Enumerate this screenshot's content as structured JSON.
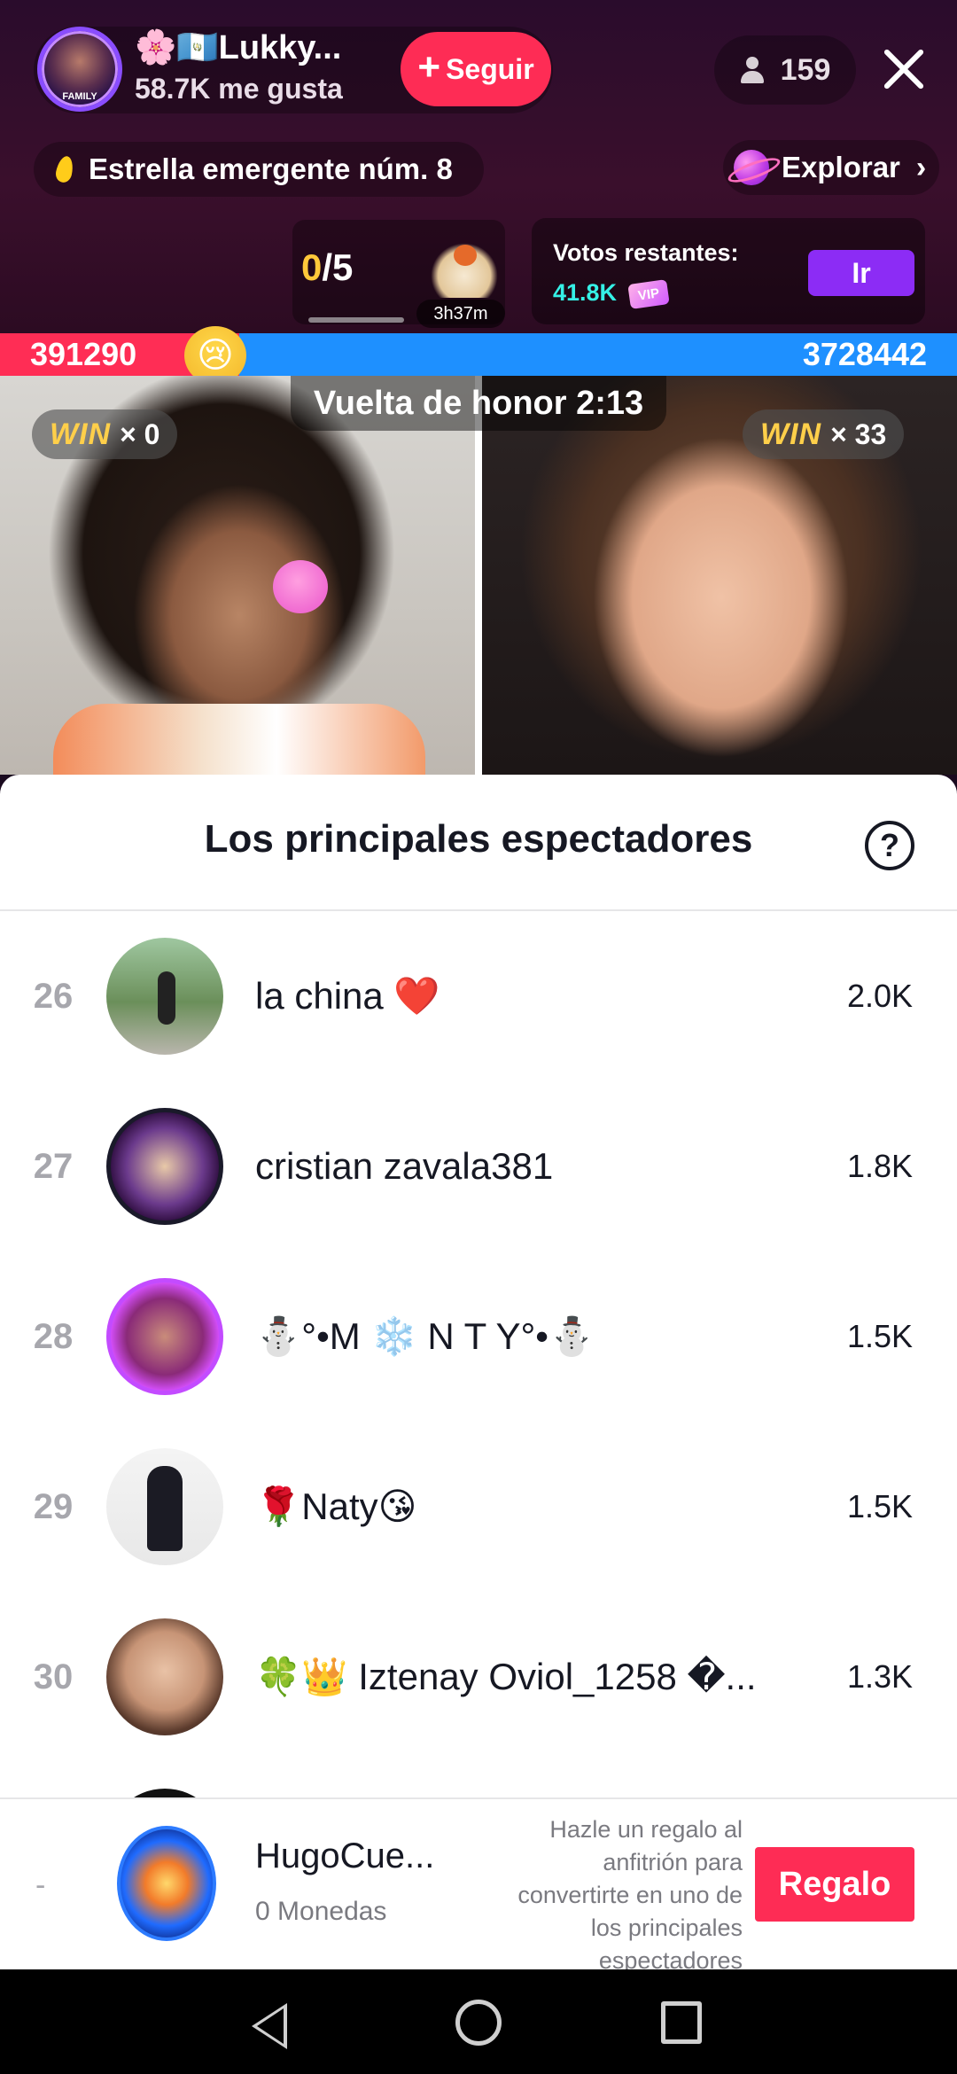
{
  "host": {
    "name": "🌸🇬🇹Lukky...",
    "likes": "58.7K me gusta",
    "follow_label": "Seguir",
    "avatar_text": "FAMILY"
  },
  "viewers": {
    "count": "159"
  },
  "badges": {
    "star_label": "Estrella emergente núm. 8",
    "explore_label": "Explorar"
  },
  "goal": {
    "current": "0",
    "total": "/5",
    "time": "3h37m",
    "progress": 0
  },
  "votes": {
    "label": "Votos restantes:",
    "value": "41.8K",
    "vip": "VIP",
    "go_label": "Ir"
  },
  "battle": {
    "left_score": "391290",
    "right_score": "3728442",
    "lap_label": "Vuelta de honor 2:13",
    "left_win_text": "WIN",
    "left_win_count": "× 0",
    "right_win_text": "WIN",
    "right_win_count": "× 33",
    "colors": {
      "left": "#ff2d55",
      "right": "#1e90ff"
    }
  },
  "sheet": {
    "title": "Los principales espectadores",
    "help": "?"
  },
  "viewers_list": [
    {
      "rank": "26",
      "name": "la china ❤️",
      "score": "2.0K"
    },
    {
      "rank": "27",
      "name": "cristian zavala381",
      "score": "1.8K"
    },
    {
      "rank": "28",
      "name": "⛄°•M ❄️ N T Y°•⛄",
      "score": "1.5K"
    },
    {
      "rank": "29",
      "name": "🌹Naty😘",
      "score": "1.5K"
    },
    {
      "rank": "30",
      "name": "🍀👑 Iztenay Oviol_1258 �...",
      "score": "1.3K"
    }
  ],
  "me": {
    "rank": "-",
    "name": "HugoCue...",
    "coins": "0 Monedas",
    "hint": "Hazle un regalo al anfitrión para convertirte en uno de los principales espectadores",
    "gift_label": "Regalo"
  },
  "colors": {
    "accent": "#fe2c55",
    "purple_button": "#8c2cf5",
    "votes_value": "#35f0e6"
  },
  "icons": {
    "close": "close-icon",
    "viewer": "person-icon",
    "flame": "flame-icon",
    "explore": "planet-icon",
    "help": "help-icon"
  }
}
